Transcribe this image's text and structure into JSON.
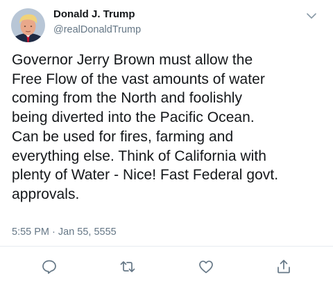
{
  "tweet": {
    "author_name": "Donald J. Trump",
    "author_handle": "@realDonaldTrump",
    "text_lines": [
      "Governor Jerry Brown must allow the",
      "Free Flow of the vast amounts of water",
      "coming from the North and foolishly",
      "being diverted into the Pacific Ocean.",
      "Can be used for fires, farming and",
      "everything else. Think of California with",
      "plenty of Water - Nice! Fast Federal govt.",
      "approvals."
    ],
    "timestamp": "5:55 PM · Jan 55, 5555"
  },
  "actions": {
    "reply_icon": "reply-icon",
    "retweet_icon": "retweet-icon",
    "like_icon": "heart-icon",
    "share_icon": "share-icon"
  },
  "colors": {
    "text": "#14171a",
    "secondary": "#657786",
    "divider": "#e6ecf0"
  }
}
